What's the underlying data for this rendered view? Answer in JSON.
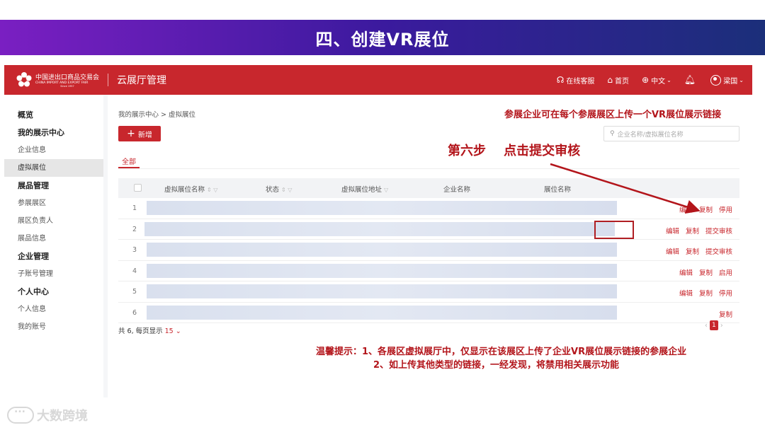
{
  "banner": {
    "title": "四、创建VR展位"
  },
  "header": {
    "logo_cn": "中国进出口商品交易会",
    "logo_en": "CHINA IMPORT AND EXPORT FAIR",
    "logo_since": "Since 1957",
    "app_title": "云展厅管理",
    "online_service": "在线客服",
    "home": "首页",
    "language": "中文",
    "user": "梁国"
  },
  "sidebar": {
    "items": [
      {
        "label": "概览",
        "type": "head"
      },
      {
        "label": "我的展示中心",
        "type": "head"
      },
      {
        "label": "企业信息",
        "type": "item"
      },
      {
        "label": "虚拟展位",
        "type": "active"
      },
      {
        "label": "展品管理",
        "type": "head"
      },
      {
        "label": "参展展区",
        "type": "item"
      },
      {
        "label": "展区负责人",
        "type": "item"
      },
      {
        "label": "展品信息",
        "type": "item"
      },
      {
        "label": "企业管理",
        "type": "head"
      },
      {
        "label": "子账号管理",
        "type": "item"
      },
      {
        "label": "个人中心",
        "type": "head"
      },
      {
        "label": "个人信息",
        "type": "item"
      },
      {
        "label": "我的账号",
        "type": "item"
      }
    ]
  },
  "main": {
    "breadcrumb": "我的展示中心 > 虚拟展位",
    "add_label": "新增",
    "search_placeholder": "企业名称/虚拟展位名称",
    "tab_all": "全部",
    "columns": [
      "虚拟展位名称",
      "状态",
      "虚拟展位地址",
      "企业名称",
      "展位名称"
    ],
    "rows": [
      {
        "index": "1",
        "ops": [
          "编辑",
          "复制",
          "停用"
        ]
      },
      {
        "index": "2",
        "ops": [
          "编辑",
          "复制",
          "提交审核"
        ]
      },
      {
        "index": "3",
        "ops": [
          "编辑",
          "复制",
          "提交审核"
        ]
      },
      {
        "index": "4",
        "ops": [
          "编辑",
          "复制",
          "启用"
        ]
      },
      {
        "index": "5",
        "ops": [
          "编辑",
          "复制",
          "停用"
        ]
      },
      {
        "index": "6",
        "ops": [
          "复制"
        ]
      }
    ],
    "footer_total": "共 6, 每页显示",
    "footer_page_size": "15",
    "current_page": "1"
  },
  "annotations": {
    "top_note": "参展企业可在每个参展展区上传一个VR展位展示链接",
    "step": "第六步    点击提交审核",
    "tip1": "温馨提示：1、各展区虚拟展厅中，仅显示在该展区上传了企业VR展位展示链接的参展企业",
    "tip2": "2、如上传其他类型的链接，一经发现，将禁用相关展示功能"
  },
  "watermark": {
    "text": "大数跨境"
  },
  "colors": {
    "brand_red": "#c8272d",
    "annotation_red": "#b3151b"
  }
}
